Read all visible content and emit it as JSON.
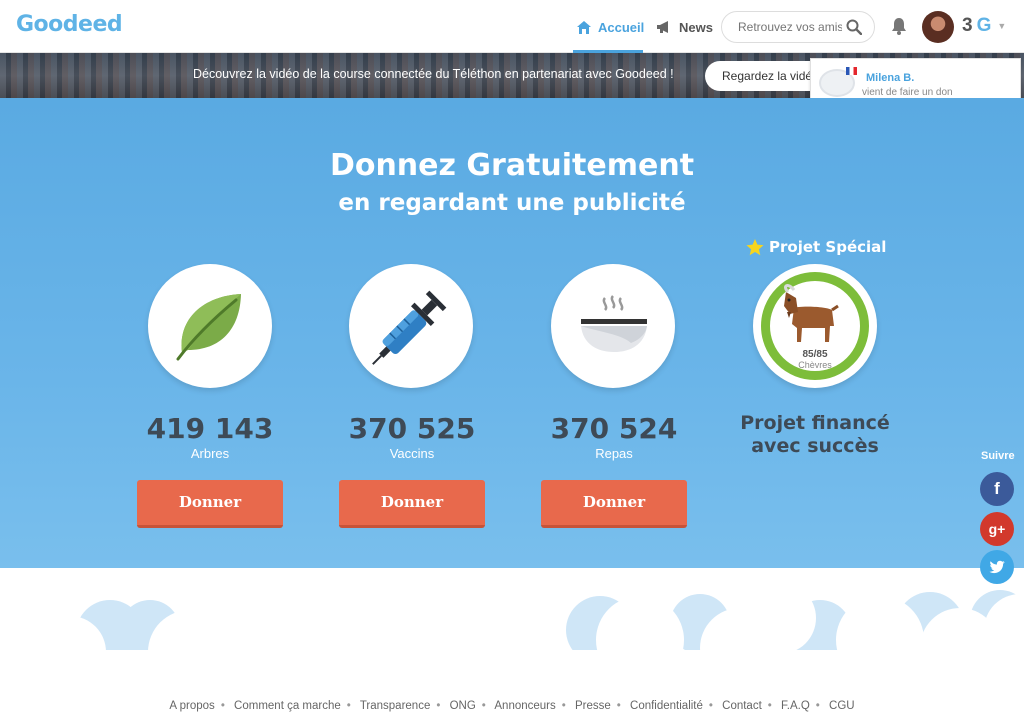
{
  "header": {
    "logo": "Goodeed",
    "nav_home": "Accueil",
    "nav_news": "News",
    "search_placeholder": "Retrouvez vos amis",
    "credits_value": "3",
    "credits_unit": "G"
  },
  "banner": {
    "text": "Découvrez la vidéo de la course connectée du Téléthon en partenariat avec Goodeed !",
    "button": "Regardez la vidéo"
  },
  "notification": {
    "name": "Milena B.",
    "message": "vient de faire un don"
  },
  "hero": {
    "title": "Donnez Gratuitement",
    "subtitle": "en regardant une publicité"
  },
  "stats": [
    {
      "value": "419 143",
      "label": "Arbres",
      "button": "Donner",
      "icon": "leaf-icon"
    },
    {
      "value": "370 525",
      "label": "Vaccins",
      "button": "Donner",
      "icon": "syringe-icon"
    },
    {
      "value": "370 524",
      "label": "Repas",
      "button": "Donner",
      "icon": "bowl-icon"
    }
  ],
  "special": {
    "heading": "Projet Spécial",
    "count": "85/85",
    "unit": "Chèvres",
    "status_line1": "Projet financé",
    "status_line2": "avec succès",
    "icon": "goat-icon",
    "progress": 1.0
  },
  "follow": {
    "label": "Suivre",
    "facebook": "f",
    "googleplus": "g+",
    "twitter": "twitter-icon"
  },
  "footer": {
    "links": [
      "A propos",
      "Comment ça marche",
      "Transparence",
      "ONG",
      "Annonceurs",
      "Presse",
      "Confidentialité",
      "Contact",
      "F.A.Q",
      "CGU"
    ]
  },
  "colors": {
    "sky": "#62b0e6",
    "brand": "#5fb3e6",
    "donate": "#e8694c",
    "success_ring": "#7dbd3a"
  }
}
